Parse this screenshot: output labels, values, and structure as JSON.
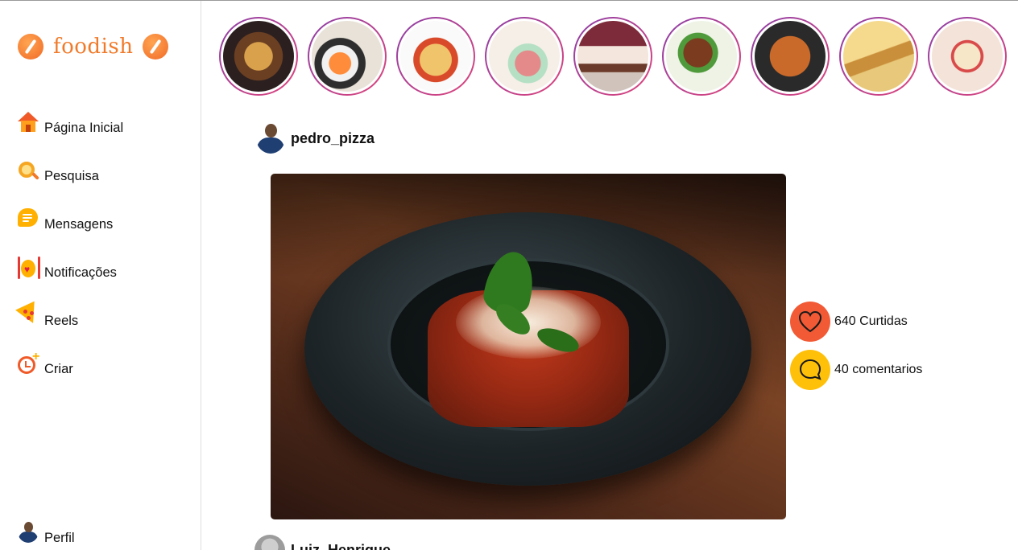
{
  "app": {
    "logo_text": "foodish"
  },
  "sidebar": {
    "items": [
      {
        "label": "Página Inicial",
        "icon": "home-icon"
      },
      {
        "label": "Pesquisa",
        "icon": "search-icon"
      },
      {
        "label": "Mensagens",
        "icon": "message-icon"
      },
      {
        "label": "Notificações",
        "icon": "notification-icon"
      },
      {
        "label": "Reels",
        "icon": "pizza-reels-icon"
      },
      {
        "label": "Criar",
        "icon": "create-icon"
      }
    ],
    "profile_label": "Perfil"
  },
  "stories": {
    "count": 9
  },
  "post": {
    "username": "pedro_pizza",
    "likes_text": "640 Curtidas",
    "comments_text": "40 comentarios"
  },
  "next_post": {
    "username": "Luiz_Henrique"
  },
  "colors": {
    "accent_orange": "#f07a2a",
    "like": "#f25a35",
    "comment": "#ffc00a",
    "story_ring_start": "#8b3fa8",
    "story_ring_end": "#e0457b"
  }
}
